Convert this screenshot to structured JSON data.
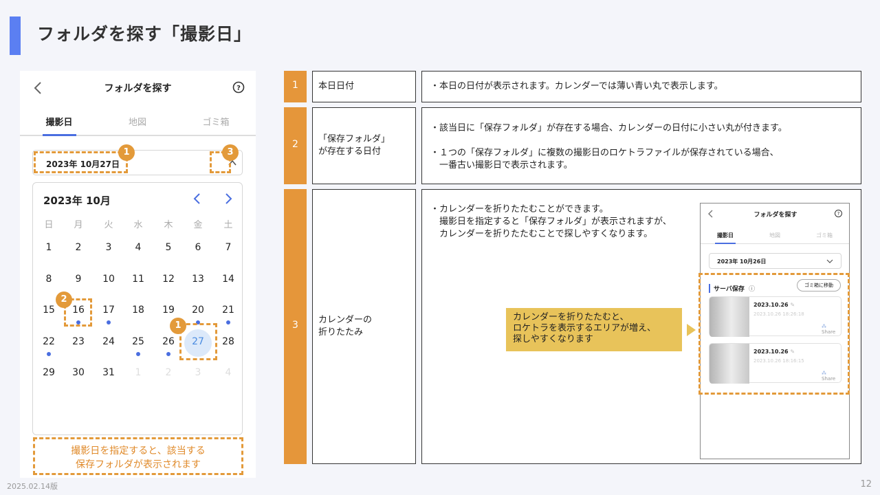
{
  "slide": {
    "title": "フォルダを探す「撮影日」",
    "footer_date": "2025.02.14版",
    "page_number": "12"
  },
  "phone": {
    "title": "フォルダを探す",
    "tabs": [
      {
        "label": "撮影日",
        "active": true
      },
      {
        "label": "地図",
        "active": false
      },
      {
        "label": "ゴミ箱",
        "active": false
      }
    ],
    "date_value": "2023年 10月27日",
    "calendar": {
      "month_label": "2023年 10月",
      "weekdays": [
        "日",
        "月",
        "火",
        "水",
        "木",
        "金",
        "土"
      ],
      "days": [
        "1",
        "2",
        "3",
        "4",
        "5",
        "6",
        "7",
        "8",
        "9",
        "10",
        "11",
        "12",
        "13",
        "14",
        "15",
        "16",
        "17",
        "18",
        "19",
        "20",
        "21",
        "22",
        "23",
        "24",
        "25",
        "26",
        "27",
        "28",
        "29",
        "30",
        "31"
      ],
      "trailing_days": [
        "1",
        "2",
        "3",
        "4"
      ],
      "today": "27",
      "days_with_folders": [
        "16",
        "17",
        "20",
        "21",
        "22",
        "25",
        "26"
      ]
    },
    "badges": {
      "date": "1",
      "chevron": "3",
      "folder_day": "2",
      "today": "1"
    },
    "note": [
      "撮影日を指定すると、該当する",
      "保存フォルダが表示されます"
    ]
  },
  "table": {
    "rows": [
      {
        "number": "1",
        "label": "本日日付",
        "description": "・本日の日付が表示されます。カレンダーでは薄い青い丸で表示します。"
      },
      {
        "number": "2",
        "label": "「保存フォルダ」\nが存在する日付",
        "description": "・該当日に「保存フォルダ」が存在する場合、カレンダーの日付に小さい丸が付きます。\n\n・１つの「保存フォルダ」に複数の撮影日のロケトラファイルが保存されている場合、\n　一番古い撮影日で表示されます。"
      },
      {
        "number": "3",
        "label": "カレンダーの\n折りたたみ",
        "description": "・カレンダーを折りたたむことができます。\n　撮影日を指定すると「保存フォルダ」が表示されますが、\n　カレンダーを折りたたむことで探しやすくなります。"
      }
    ],
    "callout": "カレンダーを折りたたむと、\nロケトラを表示するエリアが増え、\n探しやすくなります",
    "mini_phone": {
      "title": "フォルダを探す",
      "tabs": [
        "撮影日",
        "地図",
        "ゴミ箱"
      ],
      "date_value": "2023年 10月26日",
      "section_title": "サーバ保存",
      "trash_button": "ゴミ箱に移動",
      "cards": [
        {
          "date": "2023.10.26",
          "time": "2023.10.26 18:26:18",
          "share": "Share"
        },
        {
          "date": "2023.10.26",
          "time": "2023.10.26 18:16:15",
          "share": "Share"
        }
      ]
    }
  },
  "colors": {
    "accent_blue": "#5b7ff2",
    "orange": "#e5963a",
    "callout_yellow": "#e8c35a",
    "today_circle": "#dce9fa"
  }
}
